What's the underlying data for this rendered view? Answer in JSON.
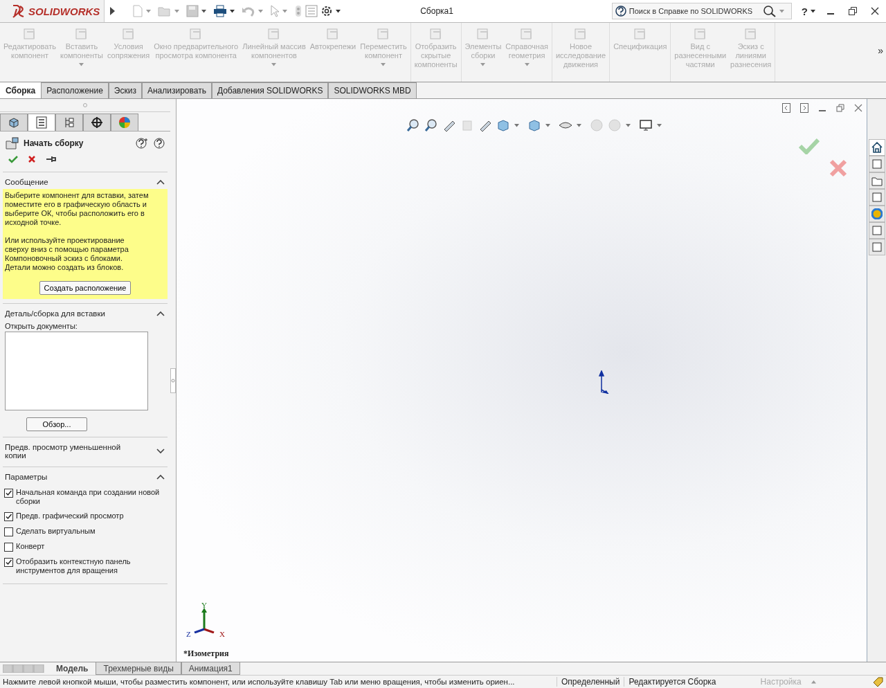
{
  "app": {
    "logo": "SOLIDWORKS",
    "title": "Сборка1",
    "search": {
      "placeholder": "Поиск в Справке по SOLIDWORKS"
    },
    "help": "?"
  },
  "ribbon": {
    "groups": [
      [
        {
          "label": "Редактировать\nкомпонент",
          "dropdown": false
        },
        {
          "label": "Вставить\nкомпоненты",
          "dropdown": true
        },
        {
          "label": "Условия\nсопряжения",
          "dropdown": false
        },
        {
          "label": "Окно предварительного\nпросмотра компонента",
          "dropdown": false
        },
        {
          "label": "Линейный массив\nкомпонентов",
          "dropdown": true
        },
        {
          "label": "Автокрепежи",
          "dropdown": false
        },
        {
          "label": "Переместить\nкомпонент",
          "dropdown": true
        }
      ],
      [
        {
          "label": "Отобразить\nскрытые\nкомпоненты",
          "dropdown": false
        }
      ],
      [
        {
          "label": "Элементы\nсборки",
          "dropdown": true
        },
        {
          "label": "Справочная\nгеометрия",
          "dropdown": true
        }
      ],
      [
        {
          "label": "Новое\nисследование\nдвижения",
          "dropdown": false
        }
      ],
      [
        {
          "label": "Спецификация",
          "dropdown": false
        }
      ],
      [
        {
          "label": "Вид с\nразнесенными\nчастями",
          "dropdown": false
        },
        {
          "label": "Эскиз с\nлиниями\nразнесения",
          "dropdown": false
        }
      ]
    ],
    "more": "»"
  },
  "command_tabs": [
    {
      "label": "Сборка",
      "selected": true
    },
    {
      "label": "Расположение",
      "selected": false
    },
    {
      "label": "Эскиз",
      "selected": false
    },
    {
      "label": "Анализировать",
      "selected": false
    },
    {
      "label": "Добавления SOLIDWORKS",
      "selected": false
    },
    {
      "label": "SOLIDWORKS MBD",
      "selected": false
    }
  ],
  "panel_tabs": [
    {
      "selected": false
    },
    {
      "selected": true
    },
    {
      "selected": false
    },
    {
      "selected": false
    },
    {
      "selected": false
    }
  ],
  "property_manager": {
    "title": "Начать сборку",
    "sections": [
      {
        "kind": "message",
        "title": "Сообщение",
        "expanded": true,
        "paragraphs": [
          "Выберите компонент для вставки, затем поместите его в графическую область и выберите ОК, чтобы расположить его в исходной точке.",
          "Или используйте проектирование сверху вниз с помощью параметра Компоновочный эскиз с блоками. Детали можно создать из блоков."
        ],
        "button": "Создать расположение"
      },
      {
        "kind": "documents",
        "title": "Деталь/сборка для вставки",
        "expanded": true,
        "label": "Открыть документы:",
        "button": "Обзор..."
      },
      {
        "title": "Предв. просмотр уменьшенной копии",
        "expanded": false
      },
      {
        "kind": "options",
        "title": "Параметры",
        "expanded": true,
        "options": [
          {
            "label": "Начальная команда при создании новой сборки",
            "checked": true
          },
          {
            "label": "Предв. графический просмотр",
            "checked": true
          },
          {
            "label": "Сделать виртуальным",
            "checked": false
          },
          {
            "label": "Конверт",
            "checked": false
          },
          {
            "label": "Отобразить контекстную панель инструментов для вращения",
            "checked": true
          }
        ]
      }
    ]
  },
  "viewport": {
    "view_name": "*Изометрия",
    "axes": {
      "x": "X",
      "y": "Y",
      "z": "Z"
    }
  },
  "bottom_tabs": [
    {
      "label": "Модель",
      "selected": true
    },
    {
      "label": "Трехмерные виды",
      "selected": false
    },
    {
      "label": "Анимация1",
      "selected": false
    }
  ],
  "status_bar": {
    "message": "Нажмите левой кнопкой мыши, чтобы разместить компонент, или используйте клавишу Tab или меню вращения, чтобы изменить ориен...",
    "state": "Определенный",
    "mode": "Редактируется Сборка",
    "units": "Настройка"
  }
}
